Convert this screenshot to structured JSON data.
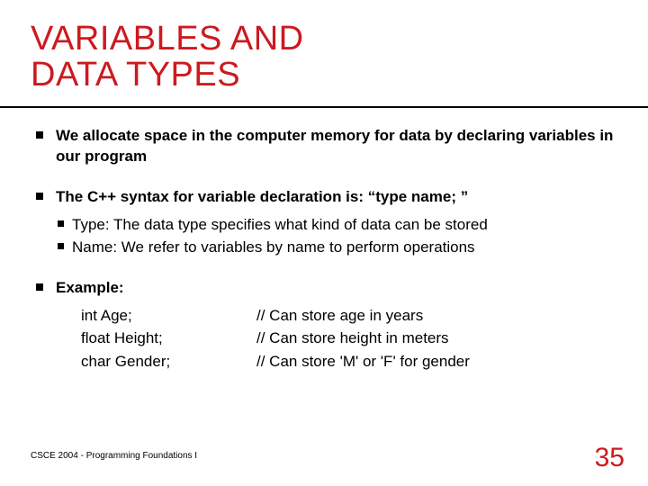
{
  "title_line1": "VARIABLES AND",
  "title_line2": "DATA TYPES",
  "bullets": {
    "b1": "We allocate space in the computer memory for data by declaring variables in our program",
    "b2": "The C++ syntax for variable declaration is: “type name; ”",
    "b2_sub": {
      "s1": "Type: The data type specifies what kind of data can be stored",
      "s2": "Name: We refer to variables by name to perform operations"
    },
    "b3": "Example:"
  },
  "example": {
    "r1": {
      "decl": "int Age;",
      "comment": "// Can store age in years"
    },
    "r2": {
      "decl": "float Height;",
      "comment": "// Can store height in meters"
    },
    "r3": {
      "decl": "char Gender;",
      "comment": "// Can store 'M' or 'F' for gender"
    }
  },
  "footer": {
    "course": "CSCE 2004 - Programming Foundations I",
    "page": "35"
  },
  "colors": {
    "accent": "#cc1a1f"
  }
}
